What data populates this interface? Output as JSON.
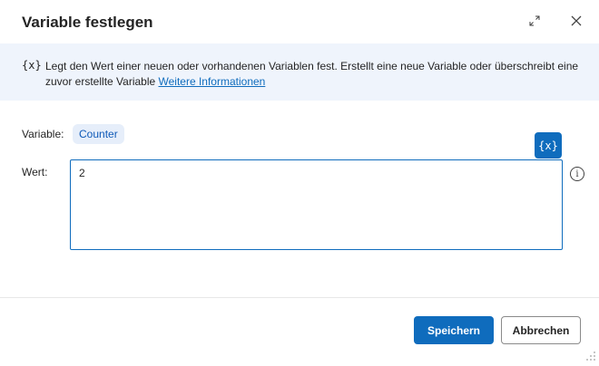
{
  "dialog": {
    "title": "Variable festlegen",
    "expand_icon": "expand-icon",
    "close_icon": "close-icon"
  },
  "info": {
    "icon_text": "{x}",
    "description": "Legt den Wert einer neuen oder vorhandenen Variablen fest. Erstellt eine neue Variable oder überschreibt eine zuvor erstellte Variable ",
    "link_label": "Weitere Informationen"
  },
  "form": {
    "variable_label": "Variable:",
    "variable_name": "Counter",
    "value_label": "Wert:",
    "value": "2",
    "variable_picker_label": "{x}",
    "help_icon": "info-circle-icon"
  },
  "footer": {
    "save_label": "Speichern",
    "cancel_label": "Abbrechen"
  },
  "colors": {
    "accent": "#0f6cbd",
    "banner_bg": "#eff4fc",
    "chip_bg": "#e6eefa"
  }
}
